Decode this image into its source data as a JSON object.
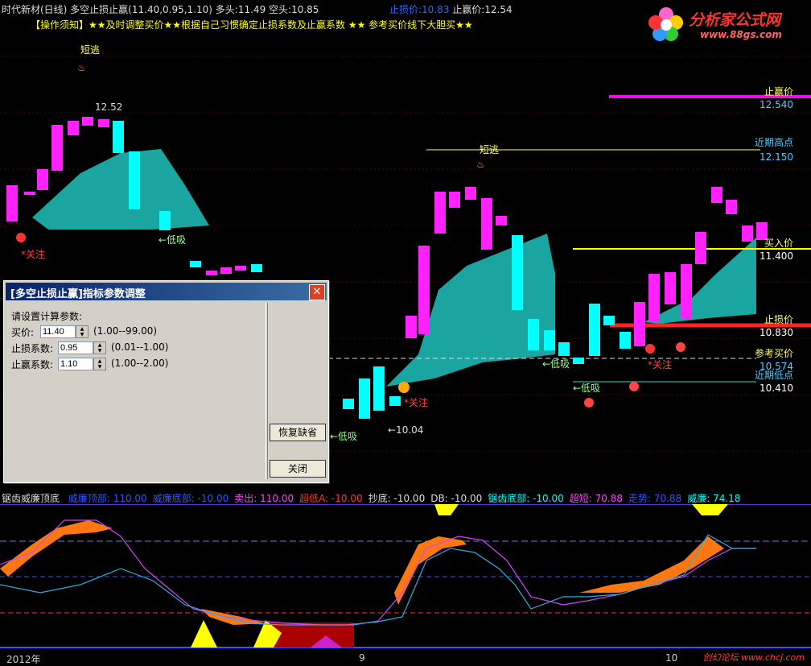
{
  "header": {
    "title": "时代新材(日线) 多空止损止赢(11.40,0.95,1.10)",
    "long_label": "多头:",
    "long_value": "11.49",
    "short_label": "空头:",
    "short_value": "10.85",
    "stop_loss_label": "止损价:",
    "stop_loss_value": "10.83",
    "take_profit_label": "止赢价:",
    "take_profit_value": "12.54"
  },
  "notice": "【操作须知】★★及时调整买价★★根据自己习惯确定止损系数及止赢系数 ★★ 参考买价线下大胆买★★",
  "logo": {
    "brand": "分析家公式网",
    "url": "www.88gs.com"
  },
  "right_labels": {
    "take_profit": {
      "label": "止赢价",
      "value": "12.540"
    },
    "recent_high": {
      "label": "近期高点",
      "value": "12.150"
    },
    "buy_price": {
      "label": "买入价",
      "value": "11.400"
    },
    "stop_loss": {
      "label": "止损价",
      "value": "10.830"
    },
    "ref_buy": {
      "label": "参考买价",
      "value": "10.574"
    },
    "recent_low": {
      "label": "近期低点",
      "value": "10.410"
    }
  },
  "chart_annotations": {
    "escape_1": "短逃",
    "escape_2": "短逃",
    "attention_1": "*关注",
    "attention_2": "*关注",
    "attention_3": "*关注",
    "dip_1": "←低吸",
    "dip_2": "←低吸",
    "dip_3": "←低吸",
    "dip_4": "←低吸",
    "high_mark": "12.52",
    "low_mark": "←10.04"
  },
  "sub_legend": {
    "name": "锯齿威廉顶底",
    "items": [
      {
        "text": "威廉顶部: 110.00",
        "color": "#3355ff"
      },
      {
        "text": "威廉底部: -10.00",
        "color": "#3355ff"
      },
      {
        "text": "卖出: 110.00",
        "color": "#ff44ff"
      },
      {
        "text": "超低A: -10.00",
        "color": "#ff3333"
      },
      {
        "text": "抄底: -10.00",
        "color": "#dddddd"
      },
      {
        "text": "DB: -10.00",
        "color": "#dddddd"
      },
      {
        "text": "锯齿底部: -10.00",
        "color": "#00ffff"
      },
      {
        "text": "超短: 70.88",
        "color": "#ff44ff"
      },
      {
        "text": "走势: 70.88",
        "color": "#3355ff"
      },
      {
        "text": "威廉: 74.18",
        "color": "#00ffff"
      }
    ]
  },
  "bottom_axis": {
    "year": "2012年",
    "m1": "9",
    "m2": "10"
  },
  "watermark": "创幻论坛 www.chcj.com",
  "dialog": {
    "title": "[多空止损止赢]指标参数调整",
    "close": "✕",
    "prompt": "请设置计算参数:",
    "fields": [
      {
        "label": "买价:",
        "value": "11.40",
        "range": "(1.00--99.00)"
      },
      {
        "label": "止损系数:",
        "value": "0.95",
        "range": "(0.01--1.00)"
      },
      {
        "label": "止赢系数:",
        "value": "1.10",
        "range": "(1.00--2.00)"
      }
    ],
    "restore_button": "恢复缺省",
    "close_button": "关闭"
  },
  "colors": {
    "up": "#ff22ff",
    "down": "#00ffff",
    "band": "#1aa5a0",
    "take_profit": "#ff00ff",
    "buy": "#ffff00",
    "stop": "#ff2222",
    "ref": "#dddddd"
  }
}
